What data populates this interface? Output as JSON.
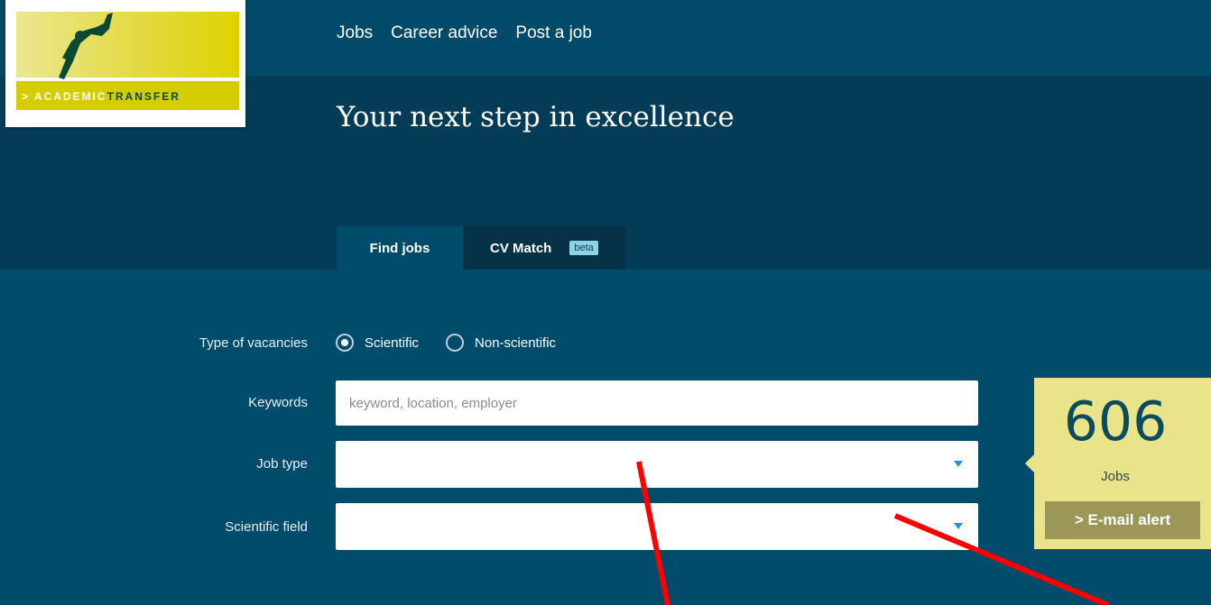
{
  "logo": {
    "prefix": "> ACADEMIC",
    "suffix": "TRANSFER"
  },
  "nav": {
    "items": [
      "Jobs",
      "Career advice",
      "Post a job"
    ]
  },
  "hero": {
    "title": "Your next step in excellence"
  },
  "tabs": [
    {
      "label": "Find jobs"
    },
    {
      "label": "CV Match",
      "badge": "beta"
    }
  ],
  "form": {
    "type_label": "Type of vacancies",
    "options": [
      "Scientific",
      "Non-scientific"
    ],
    "selected": "Scientific",
    "keywords_label": "Keywords",
    "keywords_placeholder": "keyword, location, employer",
    "job_type_label": "Job type",
    "job_type_value": "",
    "scientific_field_label": "Scientific field",
    "scientific_field_value": ""
  },
  "counter": {
    "number": "606",
    "label": "Jobs",
    "button": "> E-mail alert"
  },
  "colors": {
    "header": "#024a69",
    "hero": "#043c57",
    "body": "#014b6b",
    "accent": "#e9e48a",
    "annotation": "#ff0000"
  }
}
